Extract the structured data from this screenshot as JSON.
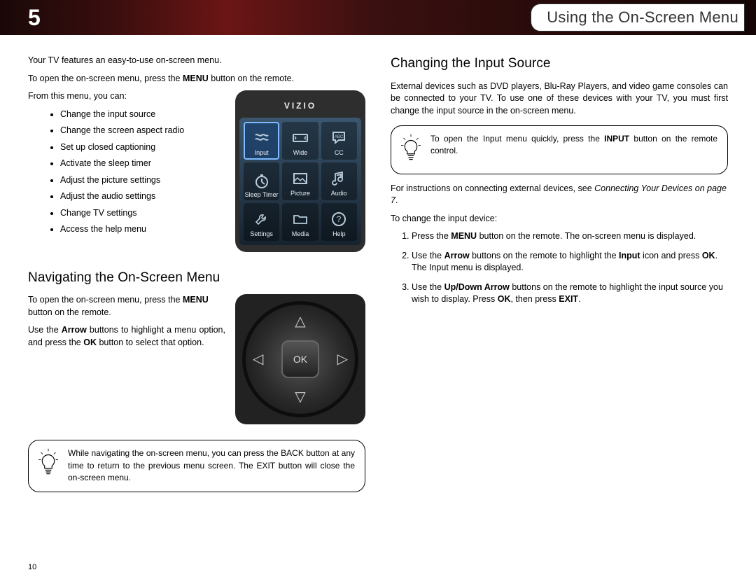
{
  "chapter": {
    "number": "5",
    "title": "Using the On-Screen Menu"
  },
  "left": {
    "intro1": "Your TV features an easy-to-use on-screen menu.",
    "intro2_pre": "To open the on-screen menu, press the ",
    "intro2_bold": "MENU",
    "intro2_post": " button on the remote.",
    "intro3": "From this menu, you can:",
    "bullets": [
      "Change the input source",
      "Change the screen aspect radio",
      "Set up closed captioning",
      "Activate the sleep timer",
      "Adjust the picture settings",
      "Adjust the audio settings",
      "Change TV settings",
      "Access the help menu"
    ],
    "nav_heading": "Navigating the On-Screen Menu",
    "nav1_pre": "To open the on-screen menu, press the ",
    "nav1_bold": "MENU",
    "nav1_post": " button on the remote.",
    "nav2_a": "Use the ",
    "nav2_b": "Arrow",
    "nav2_c": " buttons to highlight a menu option, and press the ",
    "nav2_d": "OK",
    "nav2_e": " button to select that option.",
    "tip": "While navigating the on-screen menu, you can press the BACK button at any time to return to the previous menu screen. The EXIT button will close the on-screen menu.",
    "tv": {
      "brand": "VIZIO",
      "items": [
        "Input",
        "Wide",
        "CC",
        "Sleep Timer",
        "Picture",
        "Audio",
        "Settings",
        "Media",
        "Help"
      ]
    },
    "dpad_ok": "OK"
  },
  "right": {
    "heading": "Changing the Input Source",
    "p1": "External devices such as DVD players, Blu-Ray Players, and video game consoles can be connected to your TV. To use one of these devices with your TV, you must first change the input source in the on-screen menu.",
    "tip_a": "To open the Input menu quickly, press the ",
    "tip_b": "INPUT",
    "tip_c": " button on the remote control.",
    "p2_a": "For instructions on connecting external devices, see ",
    "p2_ref": "Connecting Your Devices on page 7",
    "p2_b": ".",
    "p3": "To change the input device:",
    "steps": {
      "s1_a": "Press the ",
      "s1_b": "MENU",
      "s1_c": " button on the remote. The on-screen menu is displayed.",
      "s2_a": "Use the ",
      "s2_b": "Arrow",
      "s2_c": " buttons on the remote to highlight the ",
      "s2_d": "Input",
      "s2_e": " icon and press ",
      "s2_f": "OK",
      "s2_g": ". The Input menu is displayed.",
      "s3_a": "Use the ",
      "s3_b": "Up/Down Arrow",
      "s3_c": " buttons on the remote to highlight the input source you wish to display. Press ",
      "s3_d": "OK",
      "s3_e": ", then press ",
      "s3_f": "EXIT",
      "s3_g": "."
    }
  },
  "page_number": "10"
}
